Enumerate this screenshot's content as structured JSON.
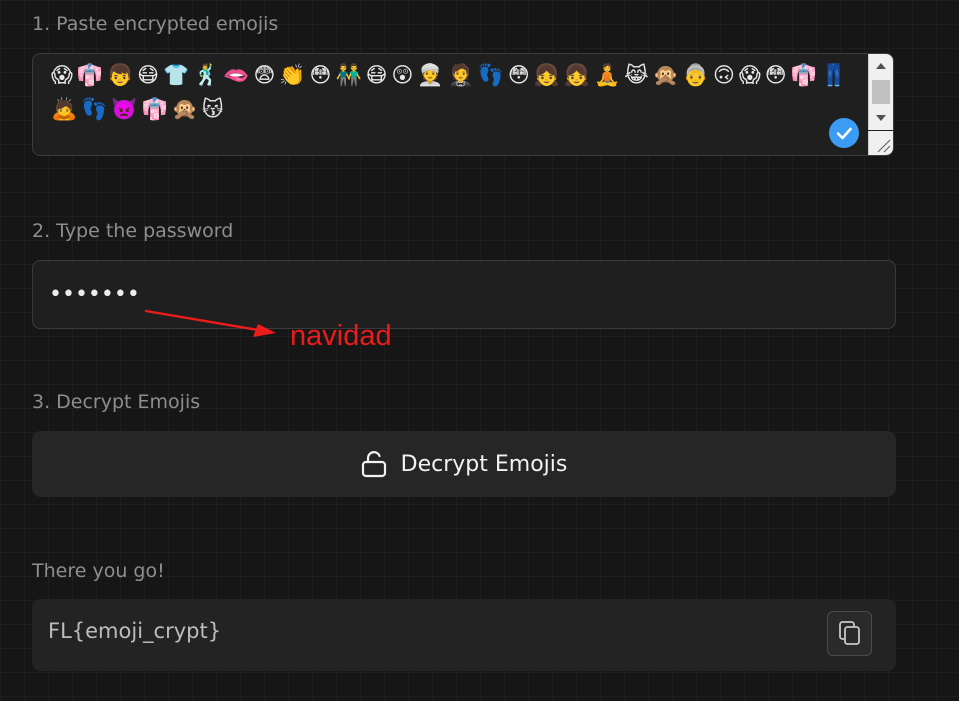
{
  "steps": {
    "paste": {
      "label": "1. Paste encrypted emojis",
      "emojis": "😱👘👦😷👕🕺🫦😨👏😳👬😷😲👳🤵👣😳👧👧🧘😹🙊👵🙃😱😳👘👖🙇👣👿👘🙊😽",
      "check_icon": "check-circle-icon",
      "accent_color": "#3b9bf5"
    },
    "password": {
      "label": "2. Type the password",
      "masked_value": "•••••••",
      "annotation": "navidad",
      "annotation_color": "#ee1b1b"
    },
    "decrypt": {
      "label": "3. Decrypt Emojis",
      "button_label": "Decrypt Emojis",
      "button_icon": "unlock-icon"
    },
    "result": {
      "label": "There you go!",
      "value": "FL{emoji_crypt}",
      "copy_icon": "copy-icon"
    }
  }
}
